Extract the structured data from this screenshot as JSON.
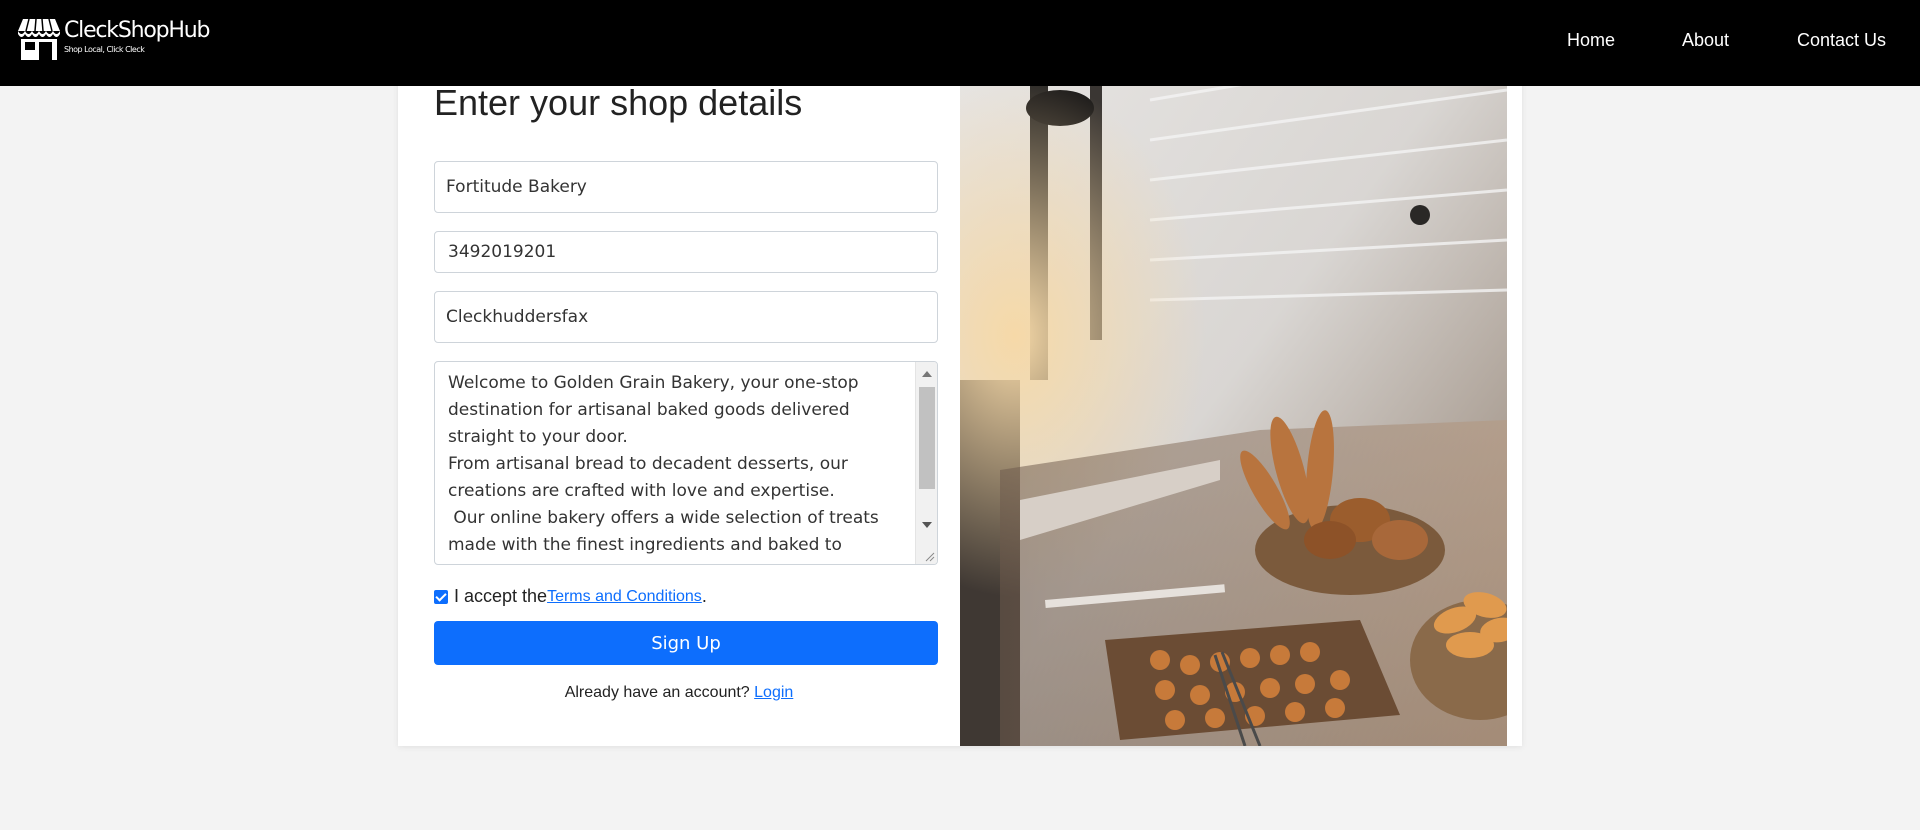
{
  "brand": {
    "name": "CleckShopHub",
    "tagline": "Shop Local, Click Cleck",
    "icon": "storefront-icon"
  },
  "nav": {
    "items": [
      {
        "label": "Home"
      },
      {
        "label": "About"
      },
      {
        "label": "Contact Us"
      }
    ]
  },
  "form": {
    "title": "Enter your shop details",
    "shop_name": "Fortitude Bakery",
    "phone": "3492019201",
    "city": "Cleckhuddersfax",
    "description": "Welcome to Golden Grain Bakery, your one-stop destination for artisanal baked goods delivered straight to your door.\nFrom artisanal bread to decadent desserts, our creations are crafted with love and expertise.\n Our online bakery offers a wide selection of treats made with the finest ingredients and baked to perfection.",
    "terms_prefix": "I accept the",
    "terms_link": "Terms and Conditions",
    "terms_suffix": ".",
    "terms_checked": true,
    "signup_label": "Sign Up",
    "login_prompt": "Already have an account?",
    "login_link": "Login"
  },
  "image": {
    "subject": "bakery-display-photo"
  },
  "colors": {
    "accent": "#0d6efd",
    "navbar": "#000000",
    "background": "#f3f3f3"
  }
}
